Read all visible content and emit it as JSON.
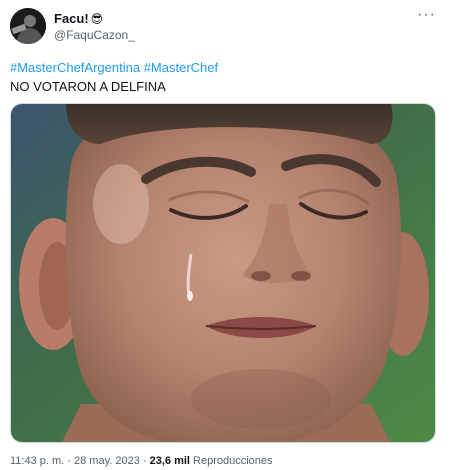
{
  "author": {
    "display_name": "Facu!",
    "name_emoji": "😎",
    "handle": "@FaquCazon_"
  },
  "menu": {
    "more_label": "···"
  },
  "tweet": {
    "hashtags": [
      "#MasterChefArgentina",
      "#MasterChef"
    ],
    "body": "NO VOTARON A DELFINA"
  },
  "media": {
    "icon": "photo-crying-man-eyes-closed"
  },
  "meta": {
    "time": "11:43 p. m.",
    "sep1": " · ",
    "date": "28 may. 2023",
    "sep2": " · ",
    "views_count": "23,6 mil",
    "views_label": " Reproducciones"
  },
  "colors": {
    "link": "#1d9bf0",
    "secondary_text": "#536471",
    "primary_text": "#0f1419",
    "background_green": "#4f8a46"
  }
}
